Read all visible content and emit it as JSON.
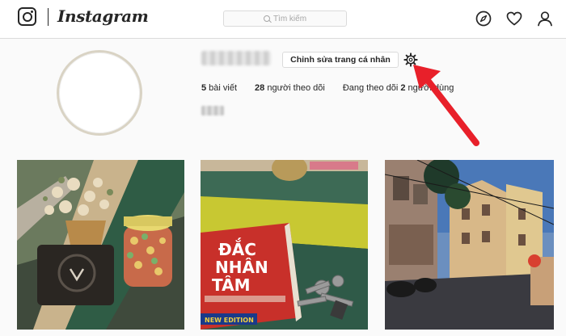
{
  "header": {
    "brand": "Instagram",
    "search_placeholder": "Tìm kiếm",
    "icons": [
      "instagram-glyph-icon",
      "search-icon",
      "compass-icon",
      "heart-icon",
      "user-icon"
    ]
  },
  "profile": {
    "edit_button_label": "Chỉnh sửa trang cá nhân",
    "stats": {
      "posts_count": "5",
      "posts_label": " bài viết",
      "followers_count": "28",
      "followers_label": " người theo dõi",
      "following_label": "Đang theo dõi ",
      "following_count": "2",
      "following_suffix": " người dùng"
    }
  },
  "posts": [
    {
      "name": "post-flowers-jar"
    },
    {
      "name": "post-book-dac-nhan-tam",
      "book_lines": [
        "ĐẮC",
        "NHÂN",
        "TÂM"
      ],
      "edition": "NEW EDITION"
    },
    {
      "name": "post-street-alley"
    }
  ],
  "colors": {
    "annotation_arrow": "#e8202a",
    "border": "#dbdbdb",
    "text": "#262626"
  }
}
